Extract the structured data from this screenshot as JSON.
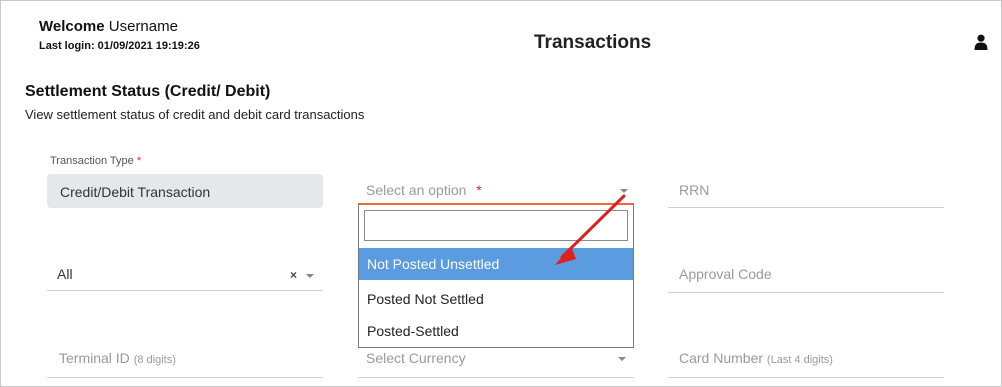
{
  "header": {
    "welcome_label": "Welcome",
    "username": "Username",
    "last_login_label": "Last login:",
    "last_login_value": "01/09/2021 19:19:26",
    "page_title": "Transactions",
    "user_icon": "user-icon"
  },
  "section": {
    "title": "Settlement Status (Credit/ Debit)",
    "subtitle": "View settlement status of credit and debit card transactions"
  },
  "form": {
    "transaction_type": {
      "label": "Transaction Type",
      "required_mark": "*",
      "value": "Credit/Debit Transaction"
    },
    "option_select": {
      "placeholder": "Select an option",
      "required_mark": "*"
    },
    "rrn": {
      "placeholder": "RRN"
    },
    "status_select": {
      "value": "All",
      "clear_symbol": "×"
    },
    "approval_code": {
      "placeholder": "Approval Code"
    },
    "terminal_id": {
      "placeholder": "Terminal ID",
      "hint": "(8 digits)"
    },
    "currency": {
      "placeholder": "Select Currency"
    },
    "card_number": {
      "placeholder": "Card Number",
      "hint": "(Last 4 digits)"
    }
  },
  "dropdown": {
    "search_value": "",
    "options": [
      {
        "label": "Not Posted Unsettled",
        "selected": true
      },
      {
        "label": "Posted Not Settled",
        "selected": false
      },
      {
        "label": "Posted-Settled",
        "selected": false
      }
    ]
  },
  "colors": {
    "highlight": "#5b9be0",
    "arrow": "#e0201c",
    "required": "#d9281f"
  }
}
